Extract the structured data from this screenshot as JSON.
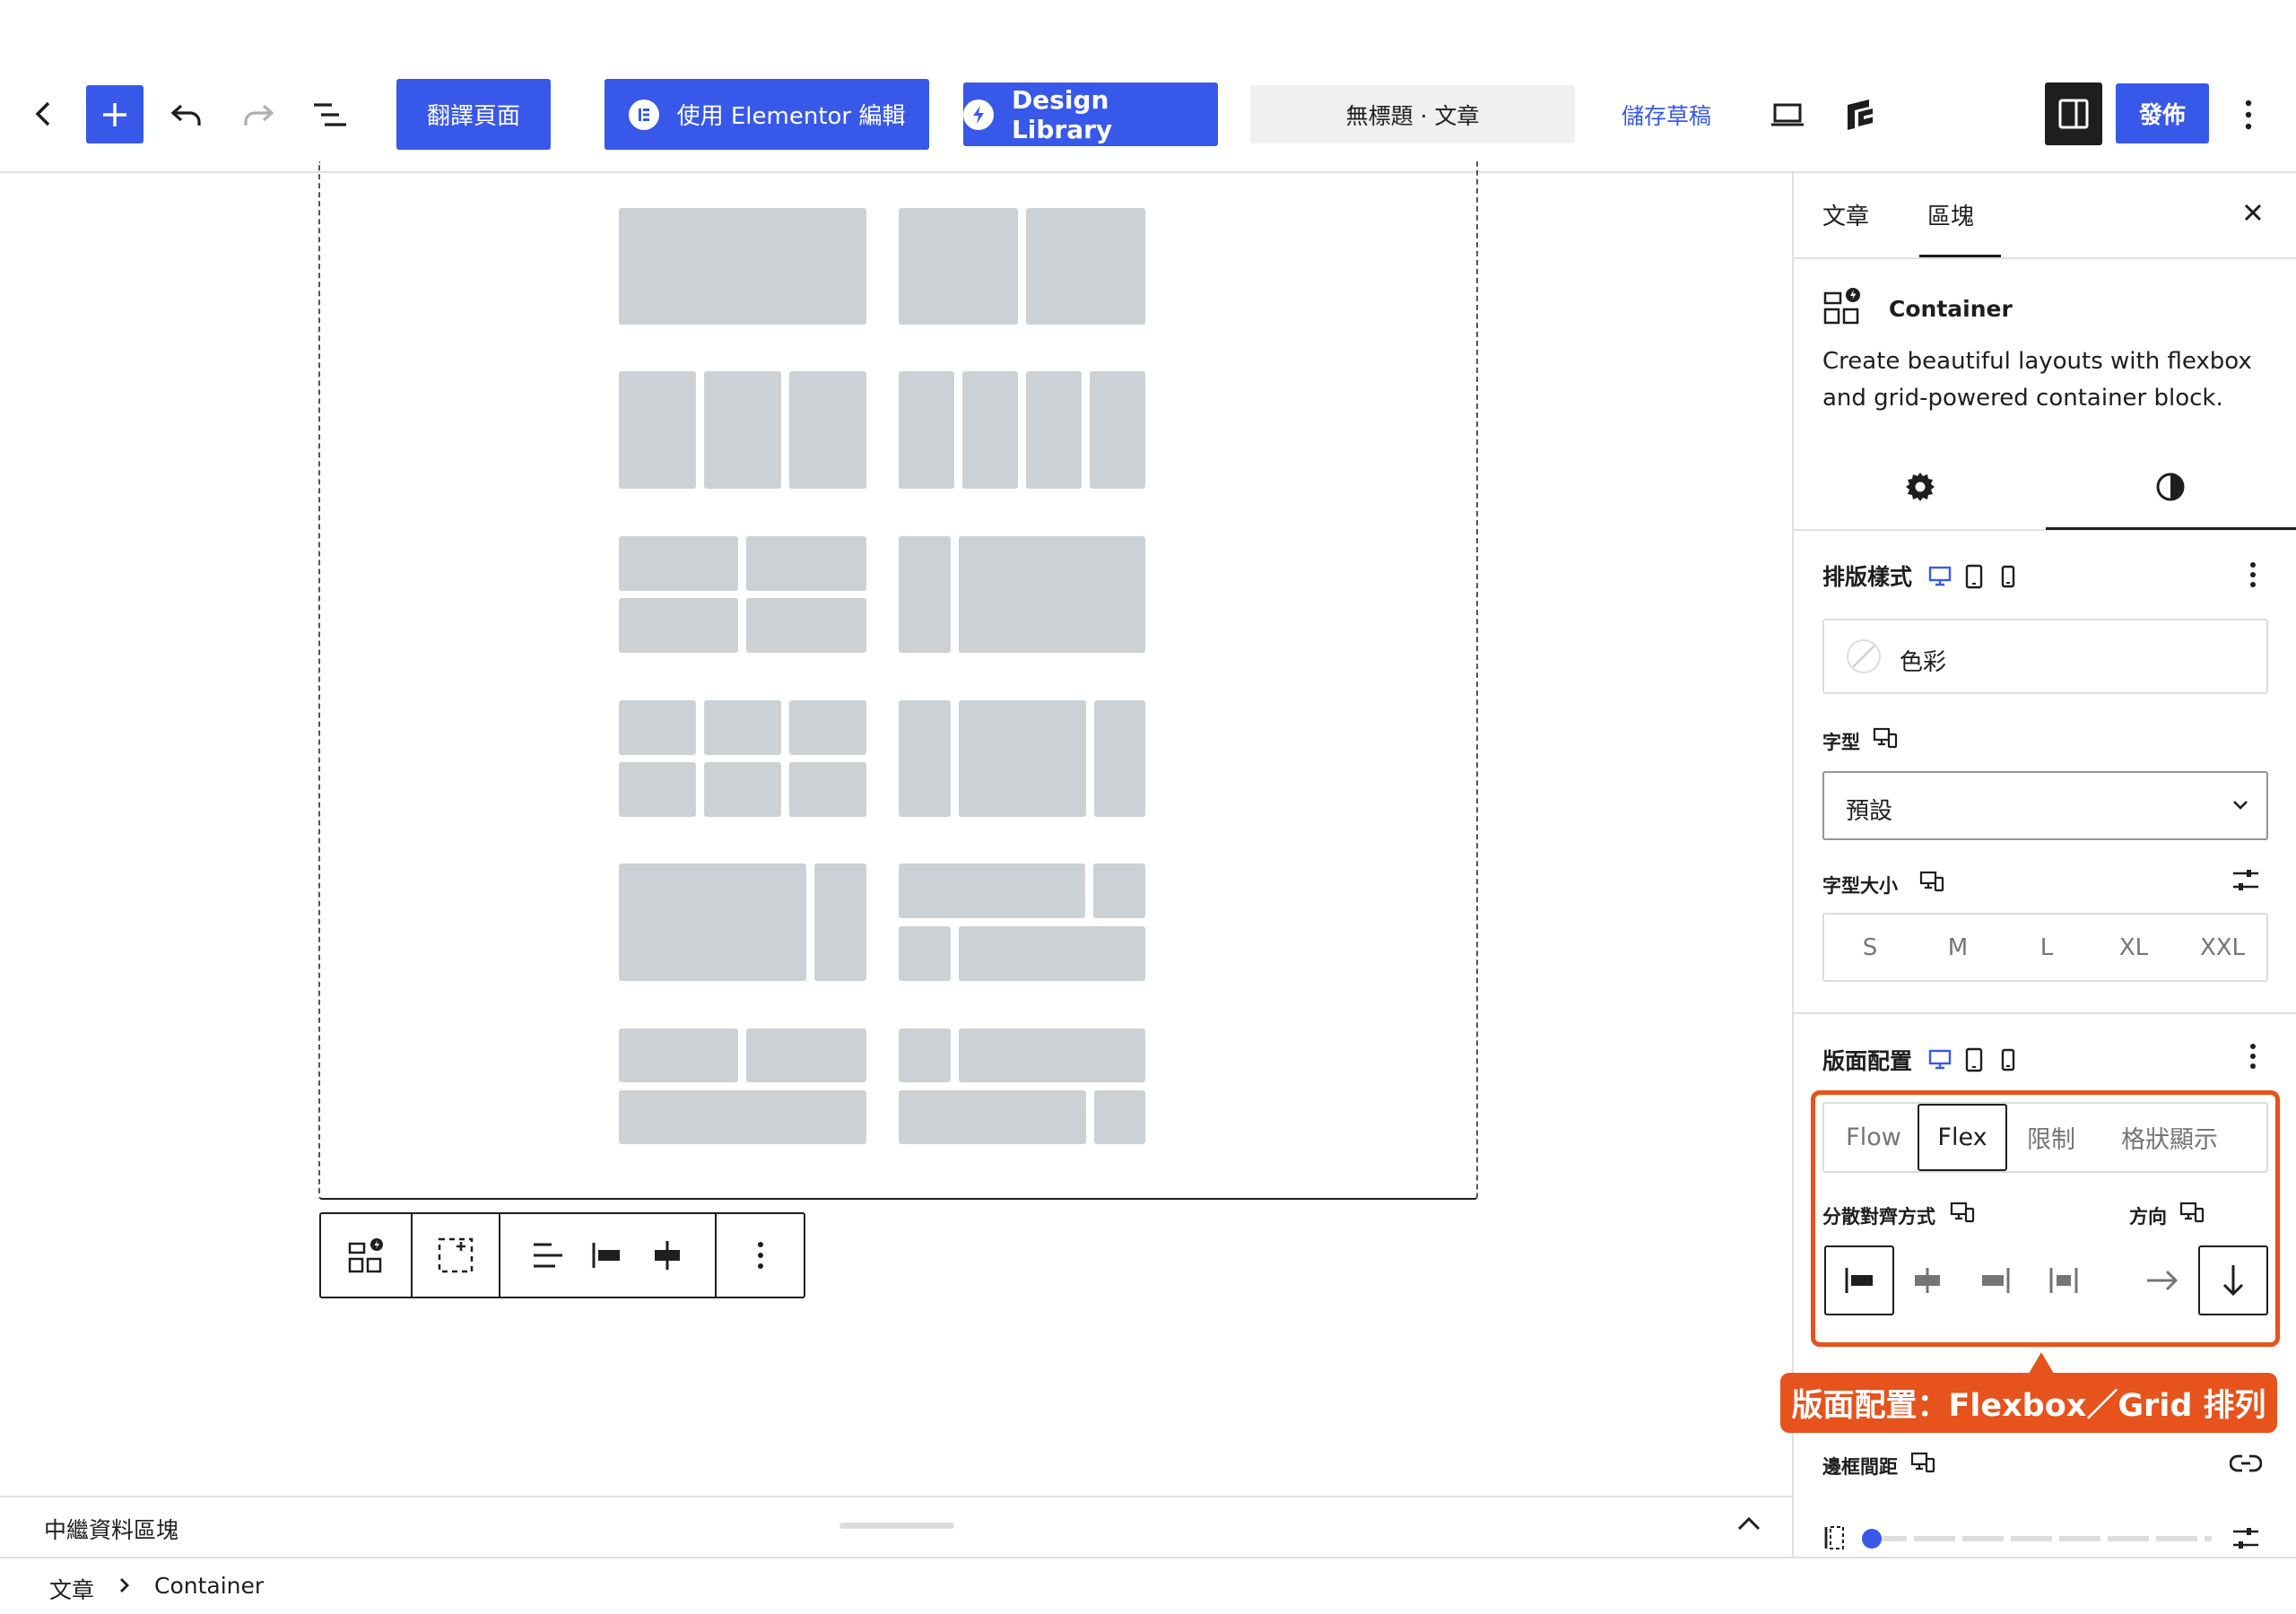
{
  "topbar": {
    "translate_label": "翻譯頁面",
    "elementor_label": "使用 Elementor 編輯",
    "design_library_label": "Design Library",
    "doc_title": "無標題 · 文章",
    "save_draft_label": "儲存草稿",
    "publish_label": "發佈"
  },
  "sidebar": {
    "tabs": [
      "文章",
      "區塊"
    ],
    "active_tab": "區塊",
    "block_name": "Container",
    "block_description": "Create beautiful layouts with flexbox and grid-powered container block.",
    "typography": {
      "title": "排版樣式",
      "color_label": "色彩",
      "font_label": "字型",
      "font_value": "預設",
      "font_size_label": "字型大小",
      "sizes": [
        "S",
        "M",
        "L",
        "XL",
        "XXL"
      ]
    },
    "layout": {
      "title": "版面配置",
      "options": [
        "Flow",
        "Flex",
        "限制",
        "格狀顯示"
      ],
      "selected": "Flex",
      "justify_label": "分散對齊方式",
      "direction_label": "方向"
    },
    "spacing_label": "邊框間距"
  },
  "callout": "版面配置：Flexbox／Grid 排列",
  "meta_box_label": "中繼資料區塊",
  "breadcrumb": [
    "文章",
    "Container"
  ],
  "colors": {
    "accent": "#3858e9",
    "callout": "#e6531c",
    "tile": "#ccd1d6"
  }
}
